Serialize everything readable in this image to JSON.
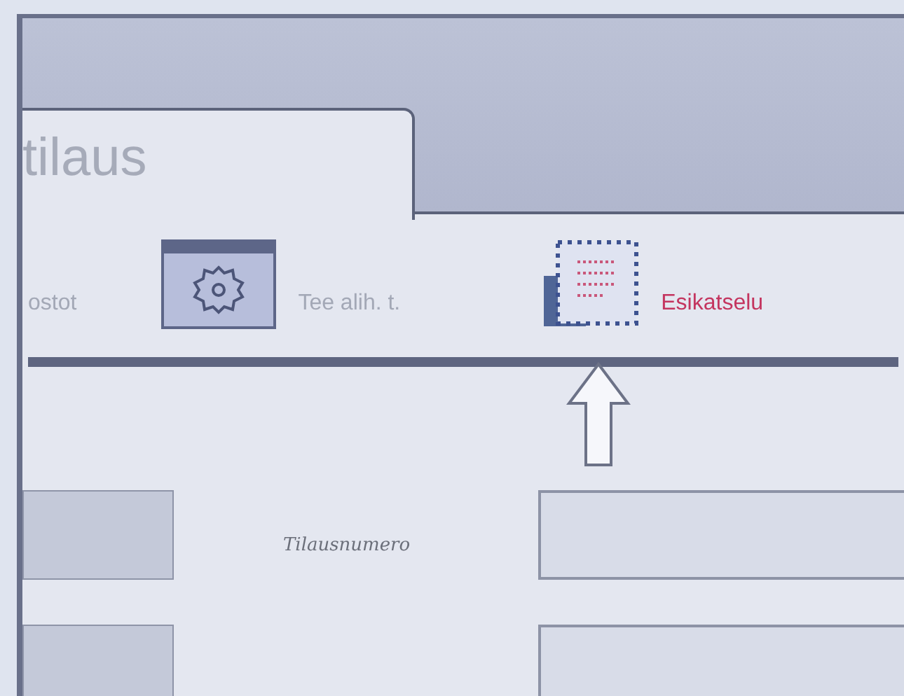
{
  "window": {
    "title": "tilaus"
  },
  "toolbar": [
    {
      "kind": "text",
      "label": "ostot",
      "hovered": false
    },
    {
      "kind": "gear-window",
      "label": "Tee alih. t.",
      "hovered": false
    },
    {
      "kind": "preview",
      "label": "Esikatselu",
      "hovered": true
    }
  ],
  "form_rows": [
    {
      "label": "Tilausnumero"
    },
    {}
  ]
}
